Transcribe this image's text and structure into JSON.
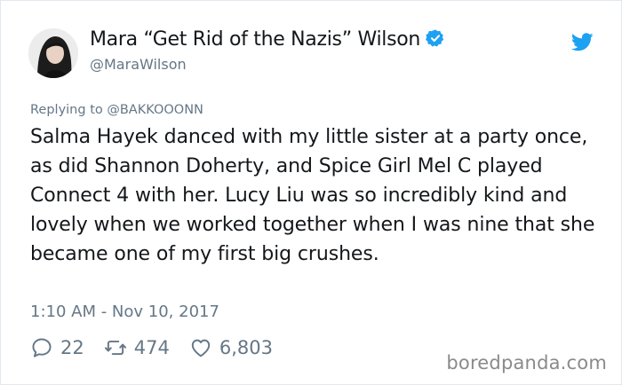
{
  "author": {
    "display_name": "Mara “Get Rid of the Nazis” Wilson",
    "handle": "@MaraWilson",
    "verified": true
  },
  "reply": {
    "prefix": "Replying to",
    "target": "@BAKKOOONN"
  },
  "tweet": {
    "text": "Salma Hayek danced with my little sister at a party once, as did Shannon Doherty, and Spice Girl Mel C played Connect 4 with her. Lucy Liu was so incredibly kind and lovely when we worked together when I was nine that she became one of my first big crushes.",
    "timestamp": "1:10 AM - Nov 10, 2017"
  },
  "actions": {
    "replies": "22",
    "retweets": "474",
    "likes": "6,803"
  },
  "icons": {
    "avatar": "profile-photo",
    "verified": "verified-badge-icon",
    "platform": "twitter-bird-icon",
    "reply": "reply-icon",
    "retweet": "retweet-icon",
    "like": "heart-icon"
  },
  "colors": {
    "accent": "#1da1f2",
    "secondary_text": "#657786",
    "primary_text": "#14171a"
  },
  "watermark": "boredpanda.com"
}
